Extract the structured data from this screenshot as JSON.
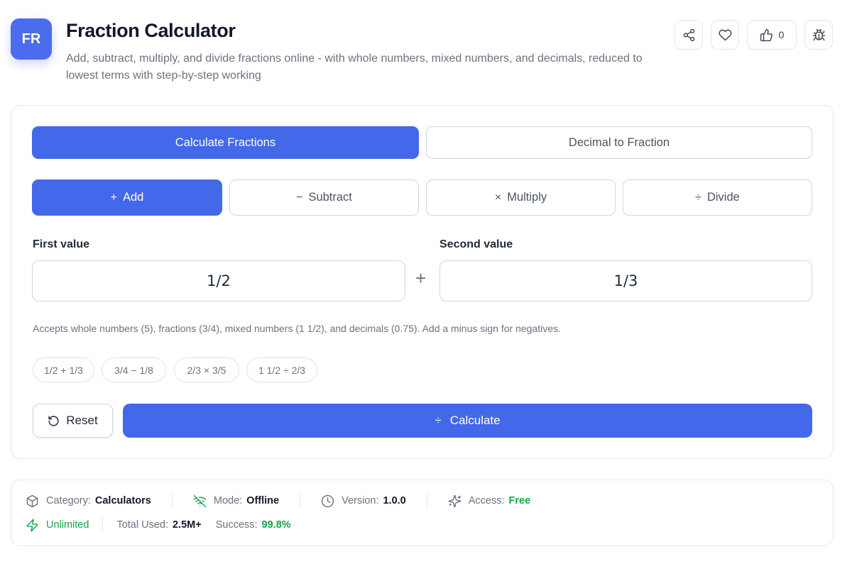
{
  "header": {
    "logo_text": "FR",
    "title": "Fraction Calculator",
    "subtitle": "Add, subtract, multiply, and divide fractions online - with whole numbers, mixed numbers, and decimals, reduced to lowest terms with step-by-step working",
    "like_count": "0",
    "icons": [
      "share-icon",
      "heart-icon",
      "thumbs-up-icon",
      "bug-icon"
    ]
  },
  "mode_tabs": [
    {
      "label": "Calculate Fractions",
      "active": true
    },
    {
      "label": "Decimal to Fraction",
      "active": false
    }
  ],
  "operations": [
    {
      "symbol": "+",
      "label": "Add",
      "active": true
    },
    {
      "symbol": "−",
      "label": "Subtract",
      "active": false
    },
    {
      "symbol": "×",
      "label": "Multiply",
      "active": false
    },
    {
      "symbol": "÷",
      "label": "Divide",
      "active": false
    }
  ],
  "inputs": {
    "first_label": "First value",
    "first_value": "1/2",
    "operator": "+",
    "second_label": "Second value",
    "second_value": "1/3"
  },
  "hint": "Accepts whole numbers (5), fractions (3/4), mixed numbers (1 1/2), and decimals (0.75). Add a minus sign for negatives.",
  "examples": [
    "1/2 + 1/3",
    "3/4 − 1/8",
    "2/3 × 3/5",
    "1 1/2 ÷ 2/3"
  ],
  "actions": {
    "reset_label": "Reset",
    "calculate_symbol": "÷",
    "calculate_label": "Calculate"
  },
  "info": {
    "category_label": "Category:",
    "category_value": "Calculators",
    "mode_label": "Mode:",
    "mode_value": "Offline",
    "version_label": "Version:",
    "version_value": "1.0.0",
    "access_label": "Access:",
    "access_value": "Free",
    "unlimited_value": "Unlimited",
    "total_label": "Total Used:",
    "total_value": "2.5M+",
    "success_label": "Success:",
    "success_value": "99.8%"
  },
  "colors": {
    "accent": "#4468ea",
    "green": "#16a34a",
    "muted": "#6b7280"
  }
}
